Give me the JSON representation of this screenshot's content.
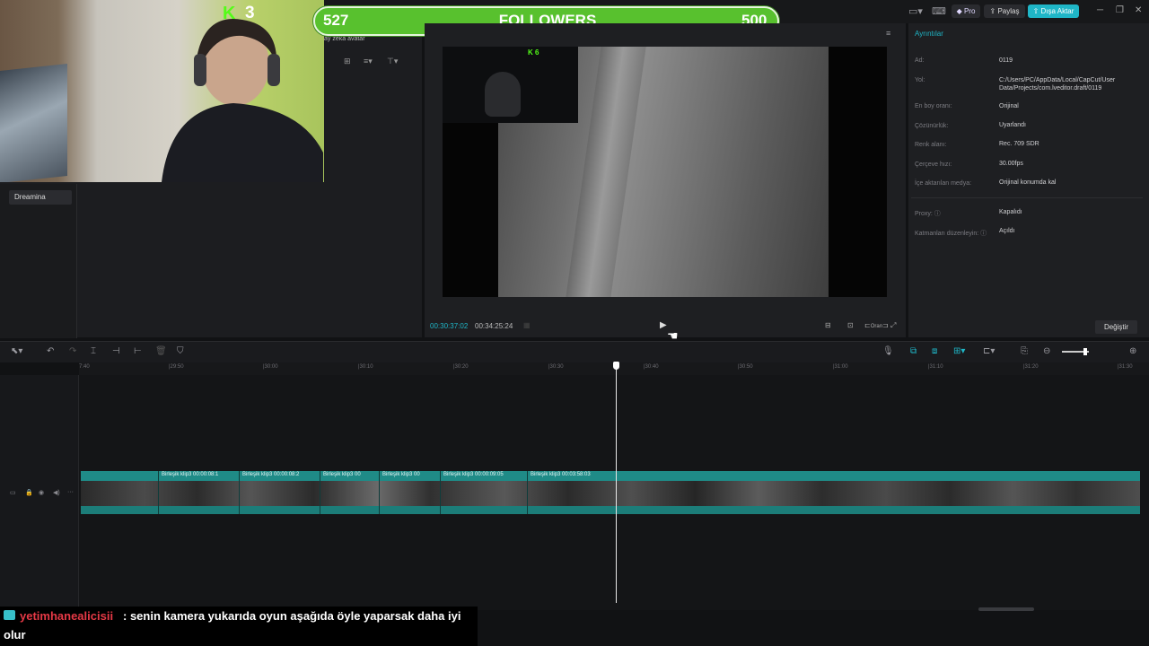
{
  "overlay": {
    "kick_count": "3",
    "followers": {
      "current": "527",
      "label": "FOLLOWERS",
      "goal": "500"
    },
    "inset_kick": "6",
    "chat": {
      "user": "yetimhanealicisii",
      "message": ": senin kamera yukarıda oyun aşağıda öyle yaparsak daha iyi",
      "message_cont": "olur"
    }
  },
  "topbar": {
    "pro": "Pro",
    "share": "Paylaş",
    "export": "Dışa Aktar"
  },
  "left_panel": {
    "ai_label": "ay zekâ avatar",
    "dreamina": "Dreamina"
  },
  "player": {
    "time_current": "00:30:37:02",
    "time_total": "00:34:25:24",
    "tool_ratio": "Oran"
  },
  "details": {
    "title": "Ayrıntılar",
    "rows": [
      {
        "key": "Ad:",
        "value": "0119"
      },
      {
        "key": "Yol:",
        "value": "C:/Users/PC/AppData/Local/CapCut/User Data/Projects/com.lveditor.draft/0119"
      },
      {
        "key": "En boy oranı:",
        "value": "Orijinal"
      },
      {
        "key": "Çözünürlük:",
        "value": "Uyarlandı"
      },
      {
        "key": "Renk alanı:",
        "value": "Rec. 709 SDR"
      },
      {
        "key": "Çerçeve hızı:",
        "value": "30.00fps"
      },
      {
        "key": "İçe aktarılan medya:",
        "value": "Orijinal konumda kal"
      },
      {
        "key": "Proxy:",
        "value": "Kapalıdı"
      },
      {
        "key": "Katmanları düzenleyin:",
        "value": "Açıldı"
      }
    ],
    "change_button": "Değiştir"
  },
  "timeline": {
    "ticks": [
      "7:40",
      "|29:50",
      "|30:00",
      "|30:10",
      "|30:20",
      "|30:30",
      "|30:40",
      "|30:50",
      "|31:00",
      "|31:10",
      "|31:20",
      "|31:30"
    ],
    "clips": [
      {
        "label": "Birleşik klip3   00:00:08:1"
      },
      {
        "label": "Birleşik klip3   00:00:08:2"
      },
      {
        "label": "Birleşik klip3   00"
      },
      {
        "label": "Birleşik klip3   00"
      },
      {
        "label": "Birleşik klip3   00:00:09:05"
      },
      {
        "label": "Birleşik klip3   00:03:58:03"
      }
    ]
  }
}
